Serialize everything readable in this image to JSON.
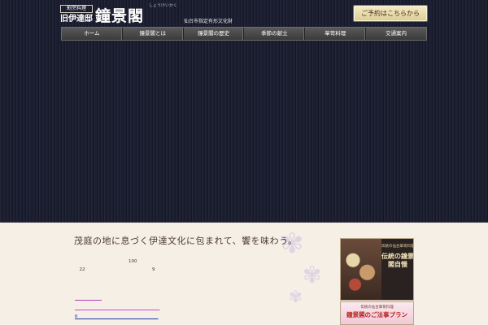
{
  "header": {
    "logo_sub": "割烹料理",
    "logo_old": "旧伊達邸",
    "logo_main": "鐘景閣",
    "logo_ruby": "しょうけいかく",
    "logo_tag": "仙台市指定有形文化財",
    "reserve_label": "ご予約はこちらから"
  },
  "nav": {
    "items": [
      "ホーム",
      "鐘景閣とは",
      "鐘景閣の歴史",
      "季節の献立",
      "箪笥料理",
      "交通案内"
    ]
  },
  "main": {
    "headline": "茂庭の地に息づく伊達文化に包まれて、饗を味わう。",
    "paragraphs": [
      "　　　　　　　　　　　　100　　　　　　　　　　　　　　　　　　　　　　　",
      "　22　　　　　　　　　　　　　　　9　　　　　　　　　　　　　　　　　　　",
      "　　　　　　　　　　　　　　　　　　　　　　　　　　　　　　　　　　　　　　　　　"
    ],
    "links": [
      "　　　　　　",
      "　　　　　　　　　　　　　　　　　　　",
      "6　　　　　　　　　　　　　　　　　　",
      "　　　　　　　　　　　"
    ]
  },
  "sidebar": {
    "banner1": {
      "small": "伝統の仙台箪笥料理",
      "big": "伝統の鐘景閣自慢"
    },
    "banner2": {
      "small": "伝統の仙台箪笥料理",
      "big": "鐘景閣のご法事プラン"
    }
  },
  "colors": {
    "hero_bg": "#1c1f31",
    "content_bg": "#f6efe6",
    "link_purple": "#b23fc2",
    "link_blue": "#1a37a8"
  }
}
